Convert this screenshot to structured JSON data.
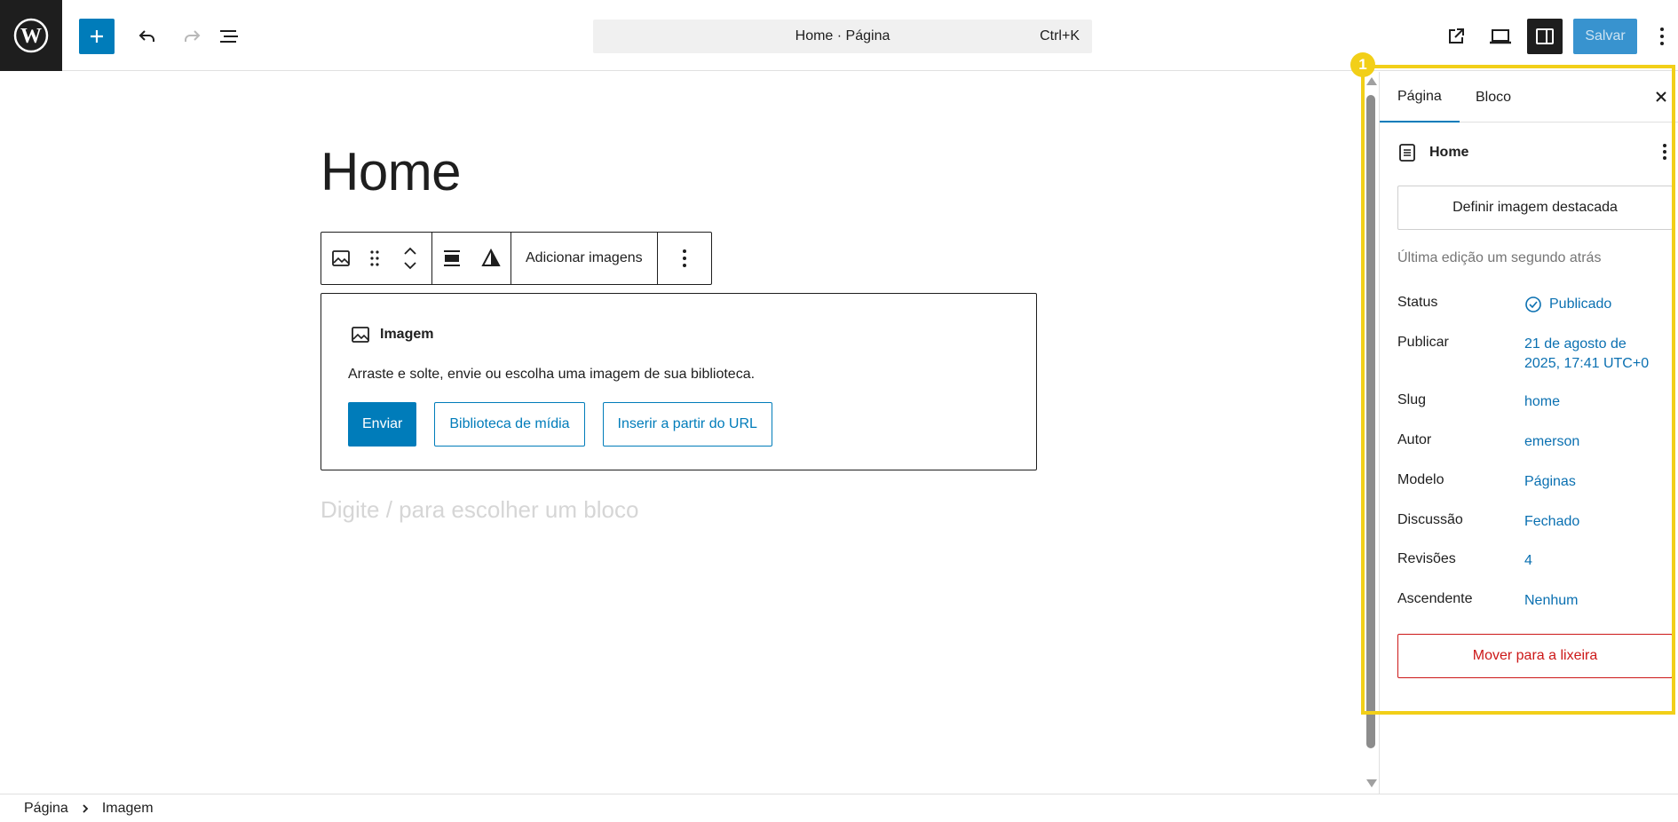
{
  "topbar": {
    "command_center": "Home · Página",
    "shortcut": "Ctrl+K",
    "save_label": "Salvar"
  },
  "editor": {
    "title": "Home",
    "toolbar_add_images": "Adicionar imagens",
    "placeholder": {
      "title": "Imagem",
      "instructions": "Arraste e solte, envie ou escolha uma imagem de sua biblioteca.",
      "upload": "Enviar",
      "media_library": "Biblioteca de mídia",
      "insert_url": "Inserir a partir do URL"
    },
    "appender": "Digite / para escolher um bloco"
  },
  "sidebar": {
    "tabs": [
      "Página",
      "Bloco"
    ],
    "doc_title": "Home",
    "featured_image": "Definir imagem destacada",
    "last_edit": "Última edição um segundo atrás",
    "meta": [
      {
        "label": "Status",
        "value": "Publicado"
      },
      {
        "label": "Publicar",
        "value": "21 de agosto de 2025, 17:41 UTC+0"
      },
      {
        "label": "Slug",
        "value": "home"
      },
      {
        "label": "Autor",
        "value": "emerson"
      },
      {
        "label": "Modelo",
        "value": "Páginas"
      },
      {
        "label": "Discussão",
        "value": "Fechado"
      },
      {
        "label": "Revisões",
        "value": "4"
      },
      {
        "label": "Ascendente",
        "value": "Nenhum"
      }
    ],
    "trash": "Mover para a lixeira"
  },
  "annotation": {
    "badge": "1"
  },
  "breadcrumb": [
    "Página",
    "Imagem"
  ],
  "colors": {
    "accent": "#007cba",
    "highlight": "#f2cf18",
    "danger": "#cc1818",
    "link": "#0a70b1"
  }
}
